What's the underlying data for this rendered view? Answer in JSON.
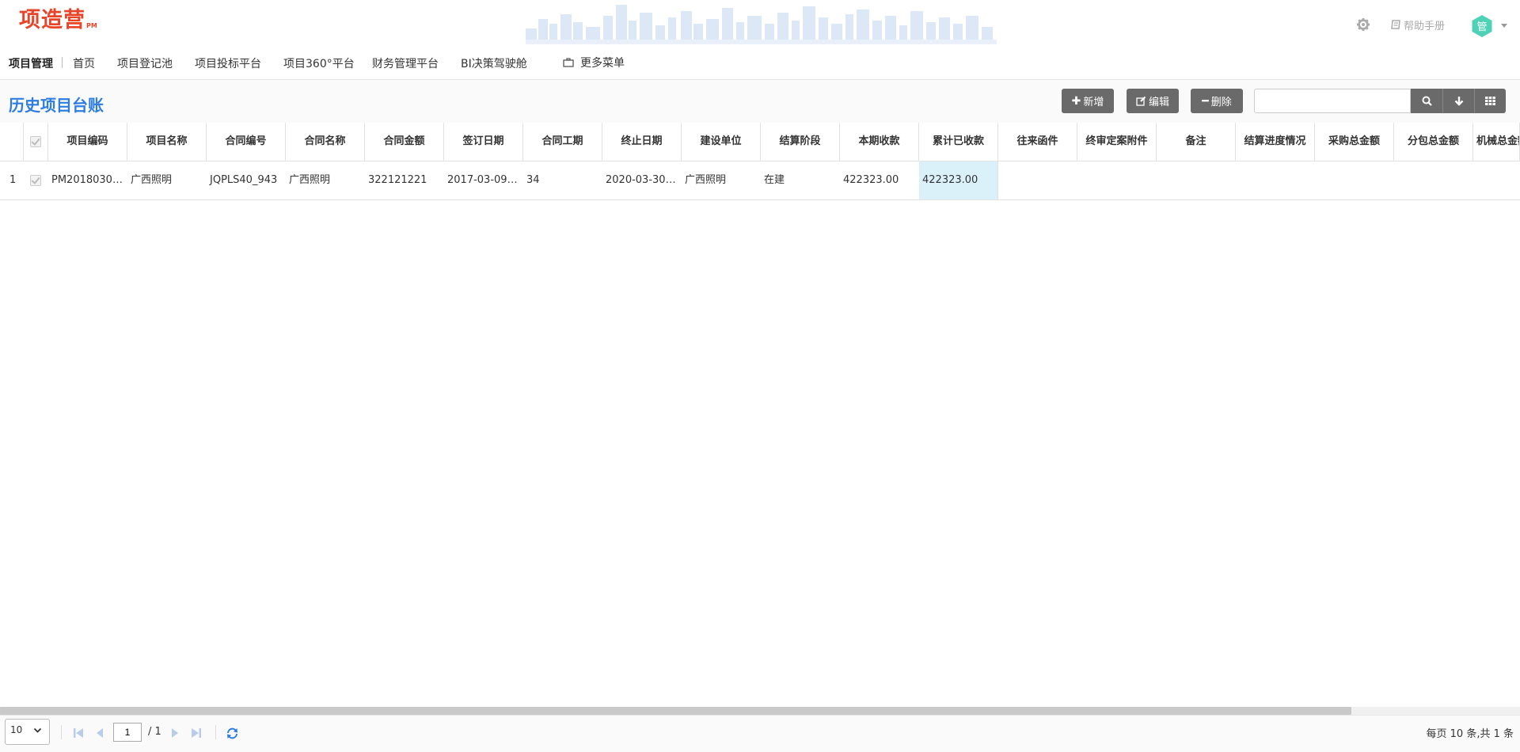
{
  "header": {
    "logo_text": "项造营",
    "logo_sub": "PM",
    "help_label": "帮助手册",
    "avatar_text": "管"
  },
  "nav": {
    "module": "项目管理",
    "items": [
      "首页",
      "项目登记池",
      "项目投标平台",
      "项目360°平台",
      "财务管理平台",
      "BI决策驾驶舱"
    ],
    "more_label": "更多菜单"
  },
  "toolbar": {
    "title": "历史项目台账",
    "add_label": "新增",
    "edit_label": "编辑",
    "delete_label": "删除",
    "search_value": ""
  },
  "table": {
    "columns": [
      "项目编码",
      "项目名称",
      "合同编号",
      "合同名称",
      "合同金额",
      "签订日期",
      "合同工期",
      "终止日期",
      "建设单位",
      "结算阶段",
      "本期收款",
      "累计已收款",
      "往来函件",
      "终审定案附件",
      "备注",
      "结算进度情况",
      "采购总金额",
      "分包总金额",
      "机械总金额"
    ],
    "rows": [
      {
        "index": "1",
        "cells": [
          "PM20180304…",
          "广西照明",
          "JQPLS40_943",
          "广西照明",
          "322121221",
          "2017-03-09 0…",
          "34",
          "2020-03-30 0…",
          "广西照明",
          "在建",
          "422323.00",
          "422323.00",
          "",
          "",
          "",
          "",
          "",
          "",
          ""
        ]
      }
    ]
  },
  "pager": {
    "page_size": "10",
    "current_page": "1",
    "total_pages": "/ 1",
    "summary": "每页 10 条,共 1 条"
  },
  "colors": {
    "accent": "#2f7de1",
    "brand": "#e8442a",
    "button": "#6a6a6a",
    "highlight_cell": "#dbf1fa",
    "avatar": "#4fd1b5"
  }
}
